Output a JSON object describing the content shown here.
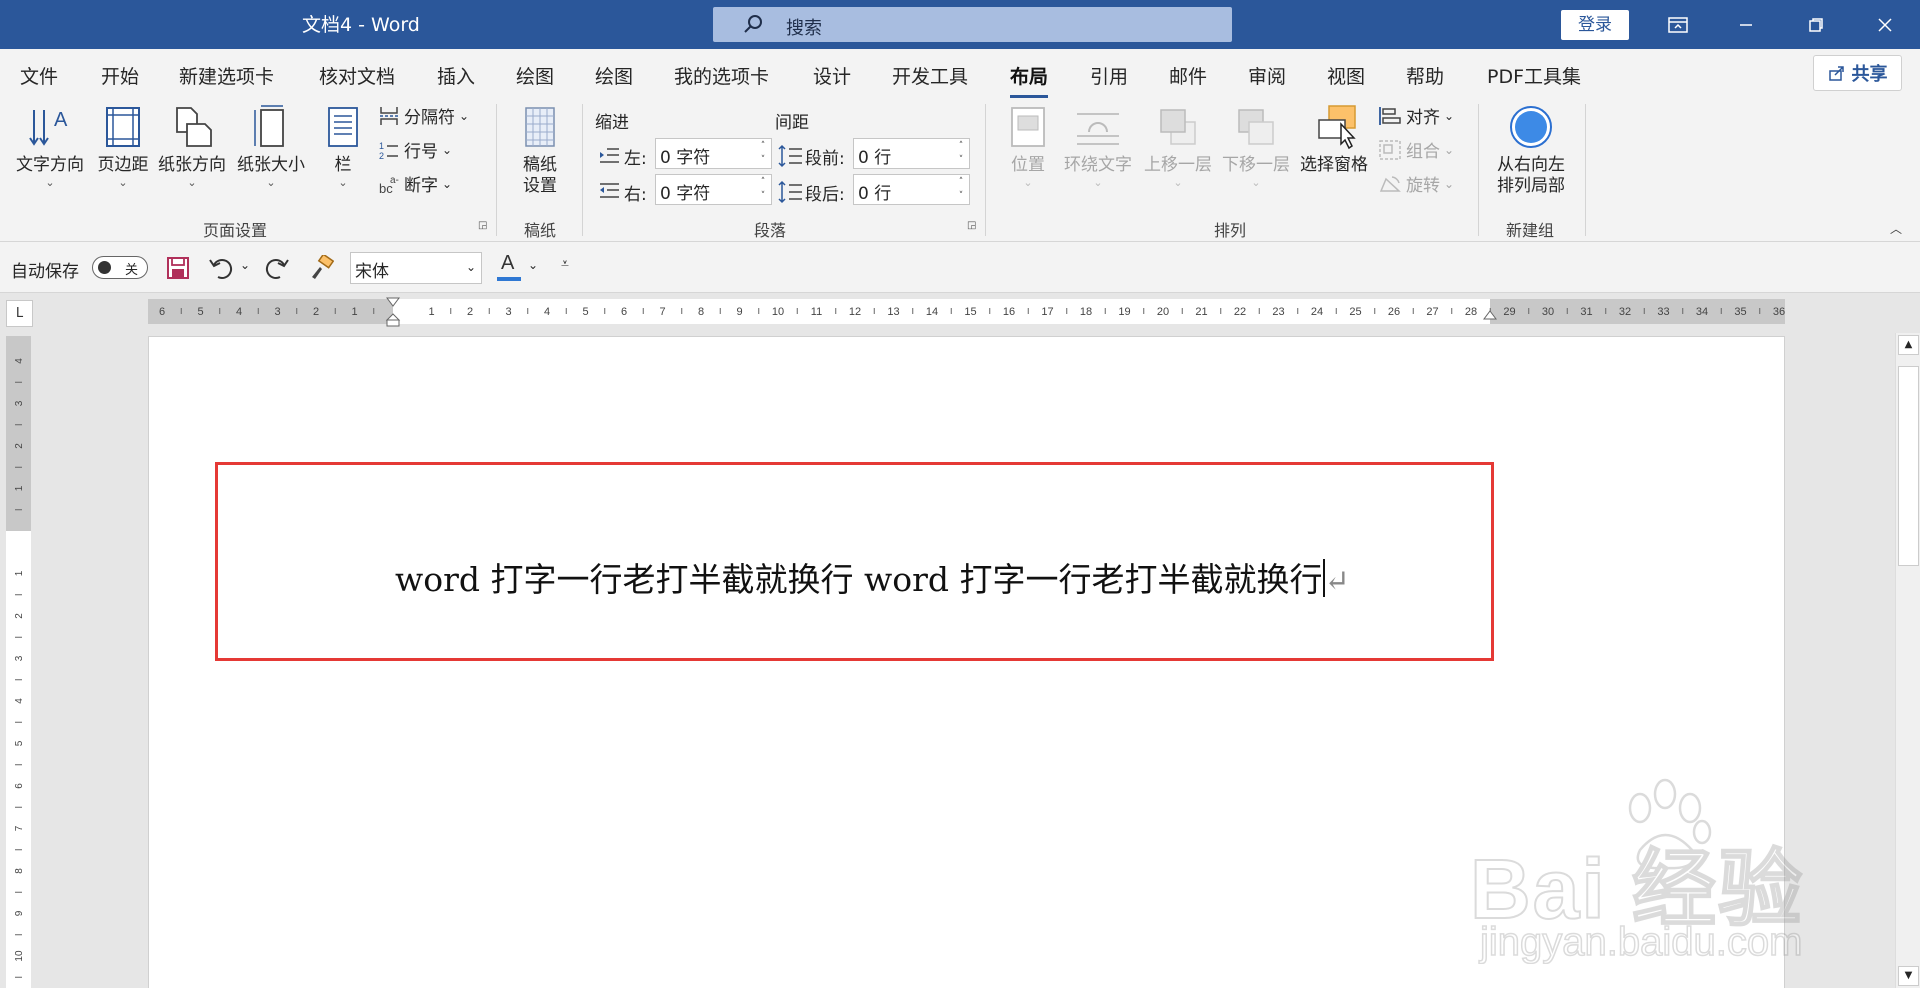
{
  "window": {
    "title": "文档4  -  Word",
    "search_placeholder": "搜索",
    "login_label": "登录"
  },
  "tabs": [
    {
      "label": "文件"
    },
    {
      "label": "开始"
    },
    {
      "label": "新建选项卡"
    },
    {
      "label": "核对文档"
    },
    {
      "label": "插入"
    },
    {
      "label": "绘图"
    },
    {
      "label": "绘图"
    },
    {
      "label": "我的选项卡"
    },
    {
      "label": "设计"
    },
    {
      "label": "开发工具"
    },
    {
      "label": "布局",
      "active": true
    },
    {
      "label": "引用"
    },
    {
      "label": "邮件"
    },
    {
      "label": "审阅"
    },
    {
      "label": "视图"
    },
    {
      "label": "帮助"
    },
    {
      "label": "PDF工具集"
    }
  ],
  "share_label": "共享",
  "ribbon": {
    "page_setup": {
      "text_direction": "文字方向",
      "margins": "页边距",
      "orientation": "纸张方向",
      "size": "纸张大小",
      "columns": "栏",
      "breaks": "分隔符",
      "line_numbers": "行号",
      "hyphenation": "断字",
      "group_label": "页面设置"
    },
    "manuscript": {
      "button": "稿纸\n设置",
      "button_line1": "稿纸",
      "button_line2": "设置",
      "group_label": "稿纸"
    },
    "paragraph": {
      "indent_label": "缩进",
      "spacing_label": "间距",
      "left_label": "左:",
      "right_label": "右:",
      "left_value": "0 字符",
      "right_value": "0 字符",
      "before_label": "段前:",
      "after_label": "段后:",
      "before_value": "0 行",
      "after_value": "0 行",
      "group_label": "段落"
    },
    "arrange": {
      "position": "位置",
      "wrap_text": "环绕文字",
      "bring_forward": "上移一层",
      "send_backward": "下移一层",
      "selection_pane": "选择窗格",
      "align": "对齐",
      "group": "组合",
      "rotate": "旋转",
      "group_label": "排列"
    },
    "new_group": {
      "button_line1": "从右向左",
      "button_line2": "排列局部",
      "group_label": "新建组"
    }
  },
  "qat": {
    "autosave_label": "自动保存",
    "autosave_state": "关",
    "font_name": "宋体",
    "font_color_glyph": "A"
  },
  "ruler": {
    "h_ticks": [
      "6",
      "5",
      "4",
      "3",
      "2",
      "1",
      "1",
      "2",
      "3",
      "4",
      "5",
      "6",
      "7",
      "8",
      "9",
      "10",
      "11",
      "12",
      "13",
      "14",
      "15",
      "16",
      "17",
      "18",
      "19",
      "20",
      "21",
      "22",
      "23",
      "24",
      "25",
      "26",
      "27",
      "28",
      "29",
      "30",
      "31",
      "32",
      "33",
      "34",
      "35",
      "36"
    ],
    "v_ticks": [
      "4",
      "3",
      "2",
      "1",
      "1",
      "2",
      "3",
      "4",
      "5",
      "6",
      "7",
      "8",
      "9",
      "10"
    ],
    "corner_glyph": "L"
  },
  "document": {
    "text": "word 打字一行老打半截就换行 word 打字一行老打半截就换行",
    "paragraph_mark": "↵"
  },
  "watermark": {
    "main": "Bai 经验",
    "sub": "jingyan.baidu.com"
  },
  "colors": {
    "title_bar": "#2b579a",
    "highlight_box": "#e53935",
    "ribbon_bg": "#f3f3f3"
  }
}
